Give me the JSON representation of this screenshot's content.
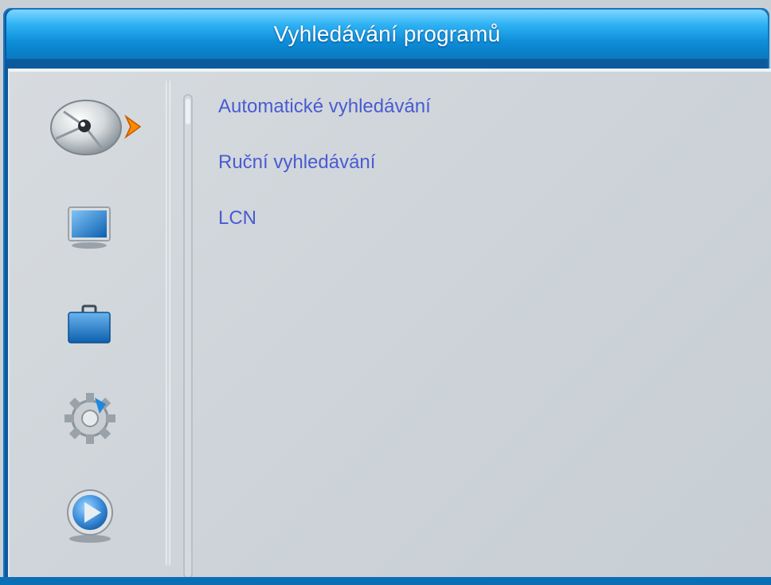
{
  "window": {
    "title": "Vyhledávání programů"
  },
  "sidebar": {
    "items": [
      {
        "icon": "satellite-dish-icon",
        "selected": true
      },
      {
        "icon": "tv-screen-icon",
        "selected": false
      },
      {
        "icon": "briefcase-icon",
        "selected": false
      },
      {
        "icon": "gear-icon",
        "selected": false
      },
      {
        "icon": "play-icon",
        "selected": false
      }
    ]
  },
  "menu": {
    "items": [
      {
        "label": "Automatické vyhledávání"
      },
      {
        "label": "Ruční vyhledávání"
      },
      {
        "label": "LCN"
      }
    ]
  },
  "colors": {
    "title_bar": "#0e8ed8",
    "menu_text": "#4a5bd1",
    "panel_bg": "#cfd5da",
    "selection_arrow": "#ff8a00"
  }
}
